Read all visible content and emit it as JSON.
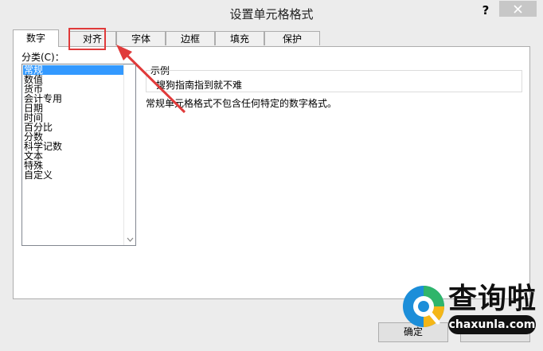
{
  "window": {
    "title": "设置单元格格式",
    "help_label": "?"
  },
  "tabs": [
    {
      "label": "数字",
      "active": true
    },
    {
      "label": "对齐",
      "active": false
    },
    {
      "label": "字体",
      "active": false
    },
    {
      "label": "边框",
      "active": false
    },
    {
      "label": "填充",
      "active": false
    },
    {
      "label": "保护",
      "active": false
    }
  ],
  "category": {
    "label": "分类(C)：",
    "items": [
      "常规",
      "数值",
      "货币",
      "会计专用",
      "日期",
      "时间",
      "百分比",
      "分数",
      "科学记数",
      "文本",
      "特殊",
      "自定义"
    ],
    "selected": "常规"
  },
  "sample": {
    "label": "示例",
    "value": "搜狗指南指到就不难"
  },
  "description": "常规单元格格式不包含任何特定的数字格式。",
  "buttons": {
    "ok_label": "确定"
  },
  "watermark": {
    "title": "查询啦",
    "url": "chaxunla.com"
  },
  "colors": {
    "annotation": "#e03a3a",
    "selection": "#3399ff"
  }
}
